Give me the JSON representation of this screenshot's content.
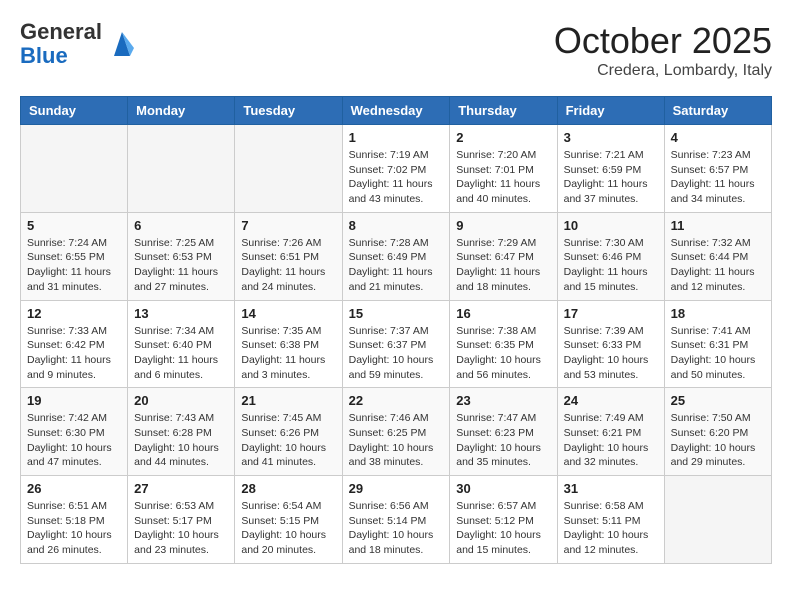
{
  "header": {
    "logo_general": "General",
    "logo_blue": "Blue",
    "month_title": "October 2025",
    "location": "Credera, Lombardy, Italy"
  },
  "days_of_week": [
    "Sunday",
    "Monday",
    "Tuesday",
    "Wednesday",
    "Thursday",
    "Friday",
    "Saturday"
  ],
  "weeks": [
    [
      {
        "day": "",
        "info": ""
      },
      {
        "day": "",
        "info": ""
      },
      {
        "day": "",
        "info": ""
      },
      {
        "day": "1",
        "info": "Sunrise: 7:19 AM\nSunset: 7:02 PM\nDaylight: 11 hours and 43 minutes."
      },
      {
        "day": "2",
        "info": "Sunrise: 7:20 AM\nSunset: 7:01 PM\nDaylight: 11 hours and 40 minutes."
      },
      {
        "day": "3",
        "info": "Sunrise: 7:21 AM\nSunset: 6:59 PM\nDaylight: 11 hours and 37 minutes."
      },
      {
        "day": "4",
        "info": "Sunrise: 7:23 AM\nSunset: 6:57 PM\nDaylight: 11 hours and 34 minutes."
      }
    ],
    [
      {
        "day": "5",
        "info": "Sunrise: 7:24 AM\nSunset: 6:55 PM\nDaylight: 11 hours and 31 minutes."
      },
      {
        "day": "6",
        "info": "Sunrise: 7:25 AM\nSunset: 6:53 PM\nDaylight: 11 hours and 27 minutes."
      },
      {
        "day": "7",
        "info": "Sunrise: 7:26 AM\nSunset: 6:51 PM\nDaylight: 11 hours and 24 minutes."
      },
      {
        "day": "8",
        "info": "Sunrise: 7:28 AM\nSunset: 6:49 PM\nDaylight: 11 hours and 21 minutes."
      },
      {
        "day": "9",
        "info": "Sunrise: 7:29 AM\nSunset: 6:47 PM\nDaylight: 11 hours and 18 minutes."
      },
      {
        "day": "10",
        "info": "Sunrise: 7:30 AM\nSunset: 6:46 PM\nDaylight: 11 hours and 15 minutes."
      },
      {
        "day": "11",
        "info": "Sunrise: 7:32 AM\nSunset: 6:44 PM\nDaylight: 11 hours and 12 minutes."
      }
    ],
    [
      {
        "day": "12",
        "info": "Sunrise: 7:33 AM\nSunset: 6:42 PM\nDaylight: 11 hours and 9 minutes."
      },
      {
        "day": "13",
        "info": "Sunrise: 7:34 AM\nSunset: 6:40 PM\nDaylight: 11 hours and 6 minutes."
      },
      {
        "day": "14",
        "info": "Sunrise: 7:35 AM\nSunset: 6:38 PM\nDaylight: 11 hours and 3 minutes."
      },
      {
        "day": "15",
        "info": "Sunrise: 7:37 AM\nSunset: 6:37 PM\nDaylight: 10 hours and 59 minutes."
      },
      {
        "day": "16",
        "info": "Sunrise: 7:38 AM\nSunset: 6:35 PM\nDaylight: 10 hours and 56 minutes."
      },
      {
        "day": "17",
        "info": "Sunrise: 7:39 AM\nSunset: 6:33 PM\nDaylight: 10 hours and 53 minutes."
      },
      {
        "day": "18",
        "info": "Sunrise: 7:41 AM\nSunset: 6:31 PM\nDaylight: 10 hours and 50 minutes."
      }
    ],
    [
      {
        "day": "19",
        "info": "Sunrise: 7:42 AM\nSunset: 6:30 PM\nDaylight: 10 hours and 47 minutes."
      },
      {
        "day": "20",
        "info": "Sunrise: 7:43 AM\nSunset: 6:28 PM\nDaylight: 10 hours and 44 minutes."
      },
      {
        "day": "21",
        "info": "Sunrise: 7:45 AM\nSunset: 6:26 PM\nDaylight: 10 hours and 41 minutes."
      },
      {
        "day": "22",
        "info": "Sunrise: 7:46 AM\nSunset: 6:25 PM\nDaylight: 10 hours and 38 minutes."
      },
      {
        "day": "23",
        "info": "Sunrise: 7:47 AM\nSunset: 6:23 PM\nDaylight: 10 hours and 35 minutes."
      },
      {
        "day": "24",
        "info": "Sunrise: 7:49 AM\nSunset: 6:21 PM\nDaylight: 10 hours and 32 minutes."
      },
      {
        "day": "25",
        "info": "Sunrise: 7:50 AM\nSunset: 6:20 PM\nDaylight: 10 hours and 29 minutes."
      }
    ],
    [
      {
        "day": "26",
        "info": "Sunrise: 6:51 AM\nSunset: 5:18 PM\nDaylight: 10 hours and 26 minutes."
      },
      {
        "day": "27",
        "info": "Sunrise: 6:53 AM\nSunset: 5:17 PM\nDaylight: 10 hours and 23 minutes."
      },
      {
        "day": "28",
        "info": "Sunrise: 6:54 AM\nSunset: 5:15 PM\nDaylight: 10 hours and 20 minutes."
      },
      {
        "day": "29",
        "info": "Sunrise: 6:56 AM\nSunset: 5:14 PM\nDaylight: 10 hours and 18 minutes."
      },
      {
        "day": "30",
        "info": "Sunrise: 6:57 AM\nSunset: 5:12 PM\nDaylight: 10 hours and 15 minutes."
      },
      {
        "day": "31",
        "info": "Sunrise: 6:58 AM\nSunset: 5:11 PM\nDaylight: 10 hours and 12 minutes."
      },
      {
        "day": "",
        "info": ""
      }
    ]
  ]
}
